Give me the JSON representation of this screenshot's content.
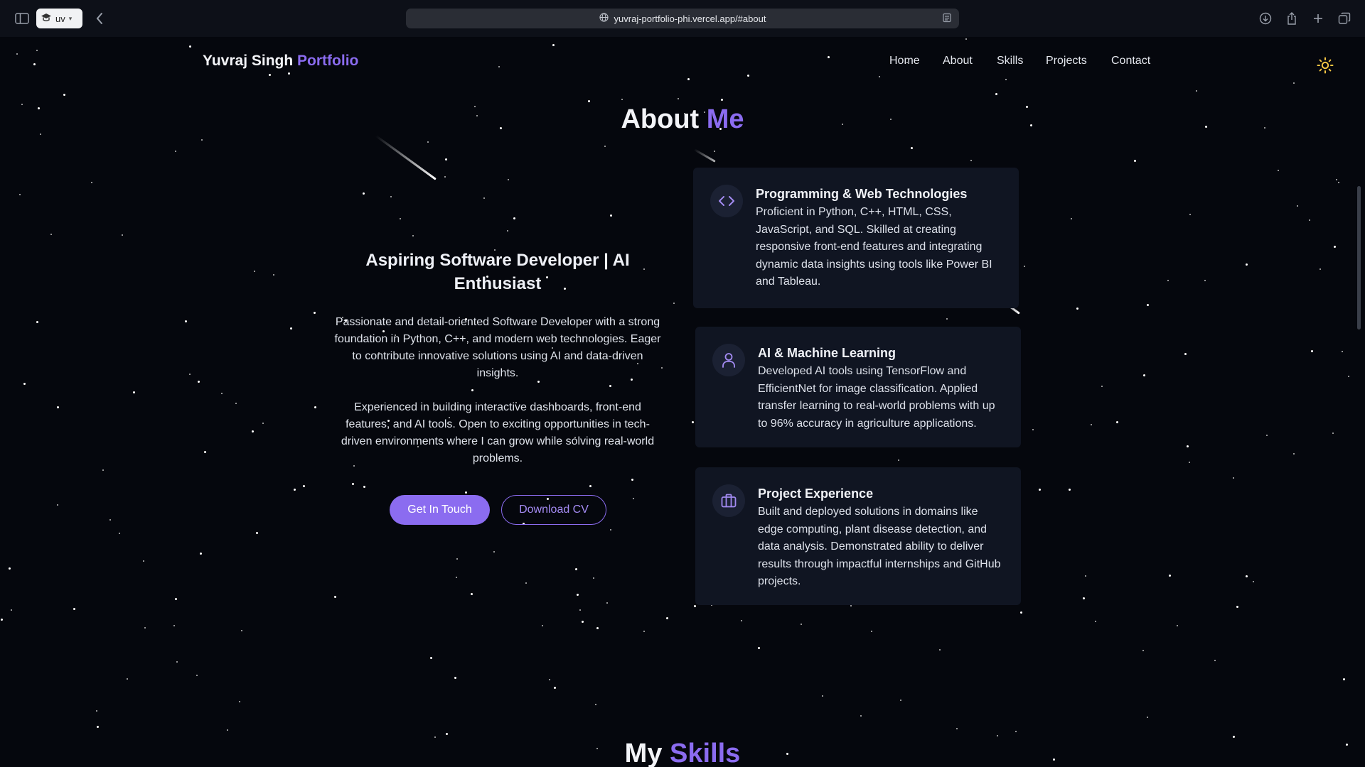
{
  "browser": {
    "profile_label": "uv",
    "url": "yuvraj-portfolio-phi.vercel.app/#about"
  },
  "nav": {
    "logo_name": "Yuvraj Singh",
    "logo_accent": "Portfolio",
    "links": [
      "Home",
      "About",
      "Skills",
      "Projects",
      "Contact"
    ]
  },
  "about": {
    "title": "About",
    "title_accent": "Me",
    "heading": "Aspiring Software Developer | AI Enthusiast",
    "paragraph1": "Passionate and detail-oriented Software Developer with a strong foundation in Python, C++, and modern web technologies. Eager to contribute innovative solutions using AI and data-driven insights.",
    "paragraph2": "Experienced in building interactive dashboards, front-end features, and AI tools. Open to exciting opportunities in tech-driven environments where I can grow while solving real-world problems.",
    "primary_button": "Get In Touch",
    "secondary_button": "Download CV"
  },
  "cards": [
    {
      "icon": "code-icon",
      "title": "Programming & Web Technologies",
      "description": "Proficient in Python, C++, HTML, CSS, JavaScript, and SQL. Skilled at creating responsive front-end features and integrating dynamic data insights using tools like Power BI and Tableau."
    },
    {
      "icon": "user-icon",
      "title": "AI & Machine Learning",
      "description": "Developed AI tools using TensorFlow and EfficientNet for image classification. Applied transfer learning to real-world problems with up to 96% accuracy in agriculture applications."
    },
    {
      "icon": "briefcase-icon",
      "title": "Project Experience",
      "description": "Built and deployed solutions in domains like edge computing, plant disease detection, and data analysis. Demonstrated ability to deliver results through impactful internships and GitHub projects."
    }
  ],
  "skills": {
    "title": "My",
    "title_accent": "Skills"
  },
  "colors": {
    "accent": "#8b6cf0",
    "background": "#05070d",
    "card": "#101522",
    "sun": "#f6c744"
  }
}
